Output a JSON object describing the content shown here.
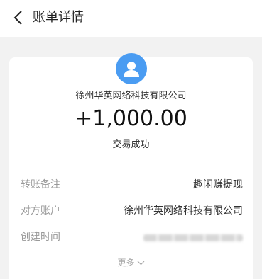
{
  "header": {
    "title": "账单详情",
    "back_icon": "chevron-left-icon"
  },
  "summary": {
    "avatar_icon": "user-icon",
    "avatar_color": "#4a9cf2",
    "payee": "徐州华英网络科技有限公司",
    "amount": "+1,000.00",
    "status": "交易成功"
  },
  "details": [
    {
      "label": "转账备注",
      "value": "趣闲赚提现"
    },
    {
      "label": "对方账户",
      "value": "徐州华英网络科技有限公司"
    },
    {
      "label": "创建时间",
      "value": ""
    }
  ],
  "more": {
    "label": "更多",
    "icon": "chevron-down-icon"
  }
}
